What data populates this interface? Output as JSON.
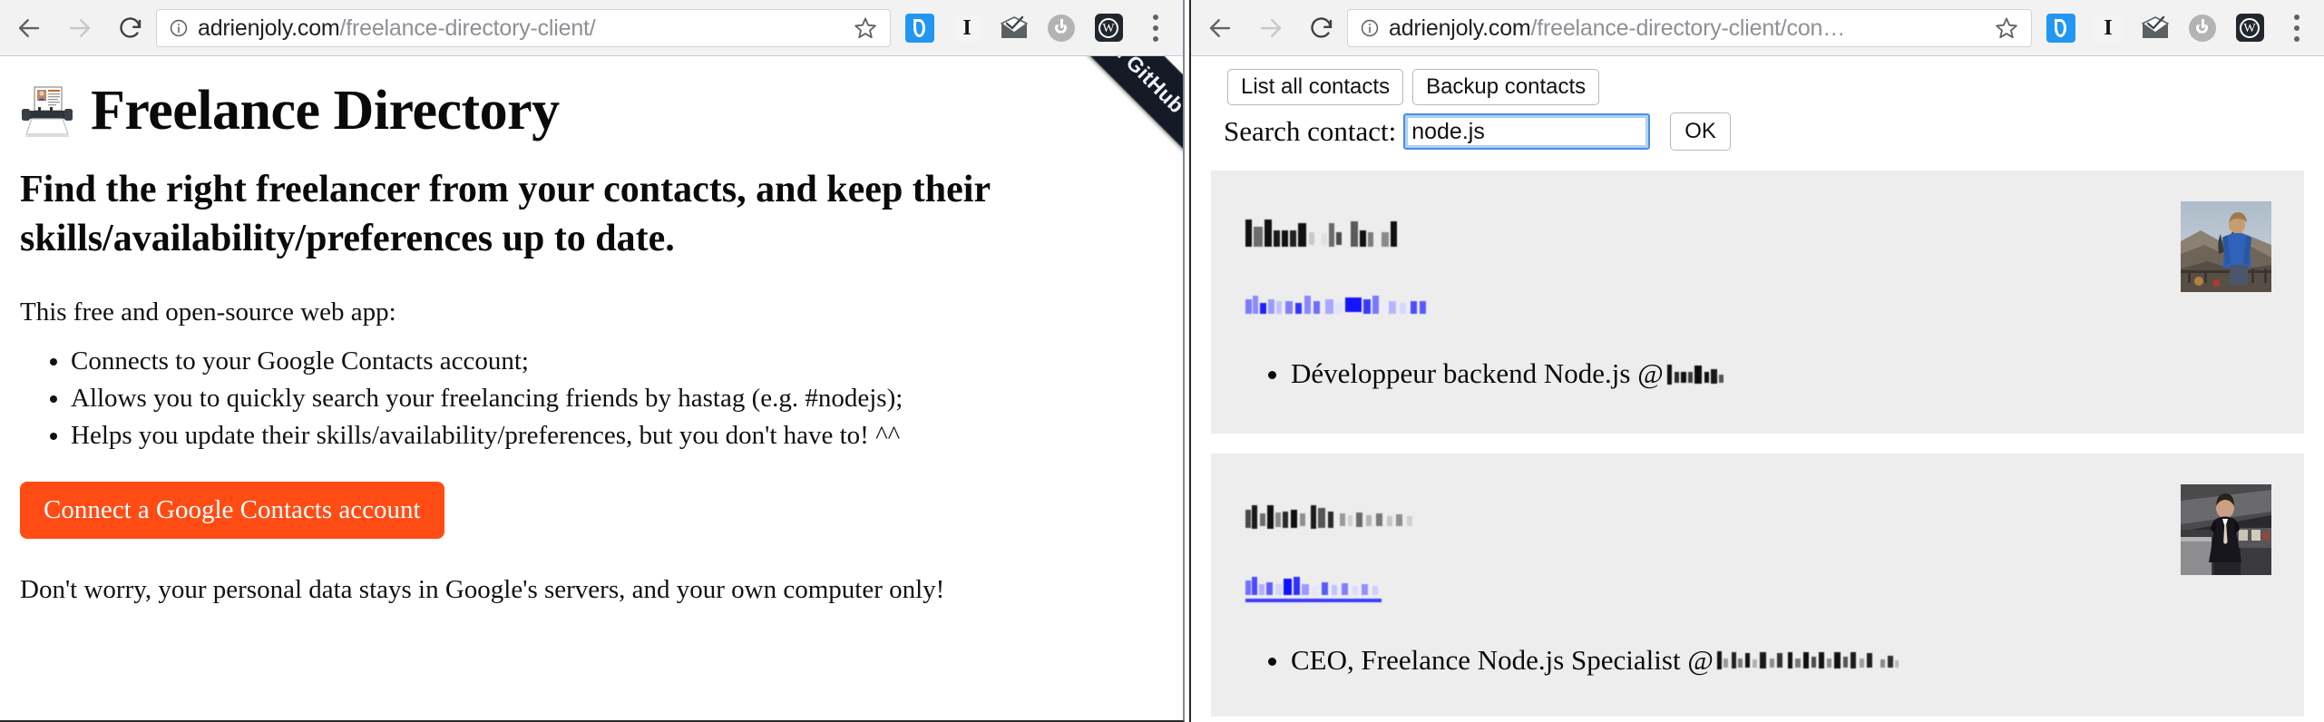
{
  "left_window": {
    "browser": {
      "back_label": "Back",
      "forward_label": "Forward",
      "reload_label": "Reload",
      "url_host": "adrienjoly.com",
      "url_path": "/freelance-directory-client/",
      "site_info_label": "View site information",
      "bookmark_label": "Bookmark this page",
      "extensions": [
        {
          "name": "d-extension-icon",
          "label": "d"
        },
        {
          "name": "instapaper-extension-icon",
          "label": "I"
        },
        {
          "name": "mail-check-extension-icon",
          "label": "Mail"
        },
        {
          "name": "power-extension-icon",
          "label": "Power"
        },
        {
          "name": "w-extension-icon",
          "label": "W"
        }
      ],
      "menu_label": "Customize and control Google Chrome"
    },
    "page": {
      "ribbon": "Fork me on GitHub",
      "title": "Freelance Directory",
      "tagline": "Find the right freelancer from your contacts, and keep their skills/availability/preferences up to date.",
      "lead": "This free and open-source web app:",
      "features": [
        "Connects to your Google Contacts account;",
        "Allows you to quickly search your freelancing friends by hastag (e.g. #nodejs);",
        "Helps you update their skills/availability/preferences, but you don't have to! ^^"
      ],
      "cta_label": "Connect a Google Contacts account",
      "footnote": "Don't worry, your personal data stays in Google's servers, and your own computer only!"
    }
  },
  "right_window": {
    "browser": {
      "back_label": "Back",
      "forward_label": "Forward",
      "reload_label": "Reload",
      "url_host": "adrienjoly.com",
      "url_path": "/freelance-directory-client/con…",
      "site_info_label": "View site information",
      "bookmark_label": "Bookmark this page",
      "extensions": [
        {
          "name": "d-extension-icon",
          "label": "d"
        },
        {
          "name": "instapaper-extension-icon",
          "label": "I"
        },
        {
          "name": "mail-check-extension-icon",
          "label": "Mail"
        },
        {
          "name": "power-extension-icon",
          "label": "Power"
        },
        {
          "name": "w-extension-icon",
          "label": "W"
        }
      ],
      "menu_label": "Customize and control Google Chrome"
    },
    "page": {
      "list_all_label": "List all contacts",
      "backup_label": "Backup contacts",
      "search_label": "Search contact:",
      "search_value": "node.js",
      "search_placeholder": "",
      "ok_label": "OK",
      "contacts": [
        {
          "name_redacted": true,
          "name_text": "",
          "link_redacted": true,
          "link_underlined": false,
          "role_prefix": "Développeur backend Node.js @",
          "role_company_redacted": true,
          "photo": "person-blue-shirt-mountain"
        },
        {
          "name_redacted": true,
          "name_text": "",
          "link_redacted": true,
          "link_underlined": true,
          "role_prefix": "CEO, Freelance Node.js Specialist @",
          "role_company_redacted": true,
          "photo": "person-suit-train-station"
        }
      ]
    }
  },
  "colors": {
    "cta_orange": "#ff4c15",
    "ribbon_navy": "#151b26",
    "card_gray": "#ededed",
    "link_blue": "#3d3dff",
    "chrome_gray": "#f2f2f2",
    "focus_blue": "#4a90e2"
  }
}
